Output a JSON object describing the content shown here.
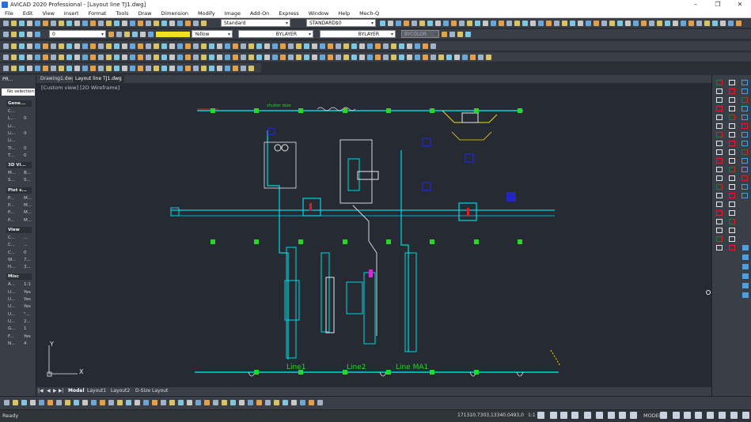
{
  "window": {
    "title": "AViCAD 2020 Professional - [Layout line TJ1.dwg]",
    "buttons": [
      "–",
      "❐",
      "✕"
    ]
  },
  "menu": [
    "File",
    "Edit",
    "View",
    "Insert",
    "Format",
    "Tools",
    "Draw",
    "Dimension",
    "Modify",
    "Image",
    "Add-On",
    "Express",
    "Window",
    "Help",
    "Mech-Q"
  ],
  "toolbar": {
    "layer_value": "0",
    "color_value": "Yellow",
    "linetype_value": "BYLAYER",
    "lineweight_value": "BYLAYER",
    "plotstyle_value": "BYCOLOR",
    "textstyle_value": "Standard",
    "dimstyle_value": "STANDARD$0"
  },
  "tabs": [
    {
      "label": "Drawing1.dwg",
      "active": false
    },
    {
      "label": "Layout line TJ1.dwg",
      "active": true
    }
  ],
  "properties": {
    "header": "PR...",
    "selection": "No selection",
    "sections": [
      {
        "title": "Gene...",
        "rows": [
          {
            "k": "C...",
            "v": ""
          },
          {
            "k": "L...",
            "v": "0"
          },
          {
            "k": "Li...",
            "v": ""
          },
          {
            "k": "Li...",
            "v": "0"
          },
          {
            "k": "Li...",
            "v": ""
          },
          {
            "k": "Tr...",
            "v": "0"
          },
          {
            "k": "T...",
            "v": "0"
          }
        ]
      },
      {
        "title": "3D Vi...",
        "rows": [
          {
            "k": "M...",
            "v": "B..."
          },
          {
            "k": "S...",
            "v": "S..."
          }
        ]
      },
      {
        "title": "Plot s...",
        "rows": [
          {
            "k": "P...",
            "v": "M..."
          },
          {
            "k": "P...",
            "v": "M..."
          },
          {
            "k": "P...",
            "v": "M..."
          },
          {
            "k": "P...",
            "v": "M..."
          }
        ]
      },
      {
        "title": "View",
        "rows": [
          {
            "k": "C...",
            "v": "..."
          },
          {
            "k": "C...",
            "v": "..."
          },
          {
            "k": "C...",
            "v": "0"
          },
          {
            "k": "W...",
            "v": "7..."
          },
          {
            "k": "H...",
            "v": "3..."
          }
        ]
      },
      {
        "title": "Misc",
        "rows": [
          {
            "k": "A...",
            "v": "1:1"
          },
          {
            "k": "U...",
            "v": "Yes"
          },
          {
            "k": "U...",
            "v": "Yes"
          },
          {
            "k": "U...",
            "v": "Yes"
          },
          {
            "k": "U...",
            "v": "\"..."
          },
          {
            "k": "U...",
            "v": "2..."
          },
          {
            "k": "G...",
            "v": "1"
          },
          {
            "k": "F...",
            "v": "Yes"
          },
          {
            "k": "N...",
            "v": "4"
          }
        ]
      }
    ]
  },
  "view_label": "[Custom view] [2D Wireframe]",
  "drawing": {
    "labels": {
      "shutter": "shutter door",
      "line1": "Line1",
      "line2": "Line2",
      "line3": "Line  MA1"
    },
    "ucs_x": "X",
    "ucs_y": "Y"
  },
  "layout_tabs": [
    {
      "label": "Model",
      "active": true
    },
    {
      "label": "Layout1",
      "active": false
    },
    {
      "label": "Layout2",
      "active": false
    },
    {
      "label": "D-Size Layout",
      "active": false
    }
  ],
  "layout_nav": [
    "|◀",
    "◀",
    "▶",
    "▶|"
  ],
  "status": {
    "ready": "Ready",
    "coords": "171310.7303,13340.0493,0",
    "scale": "1:1",
    "model": "MODEL"
  },
  "colors": {
    "cyan": "#00d8e0",
    "green": "#2ad62a",
    "yellow": "#f2e01a",
    "blue": "#2424c8",
    "white": "#e8e8e8",
    "red": "#e02020"
  }
}
